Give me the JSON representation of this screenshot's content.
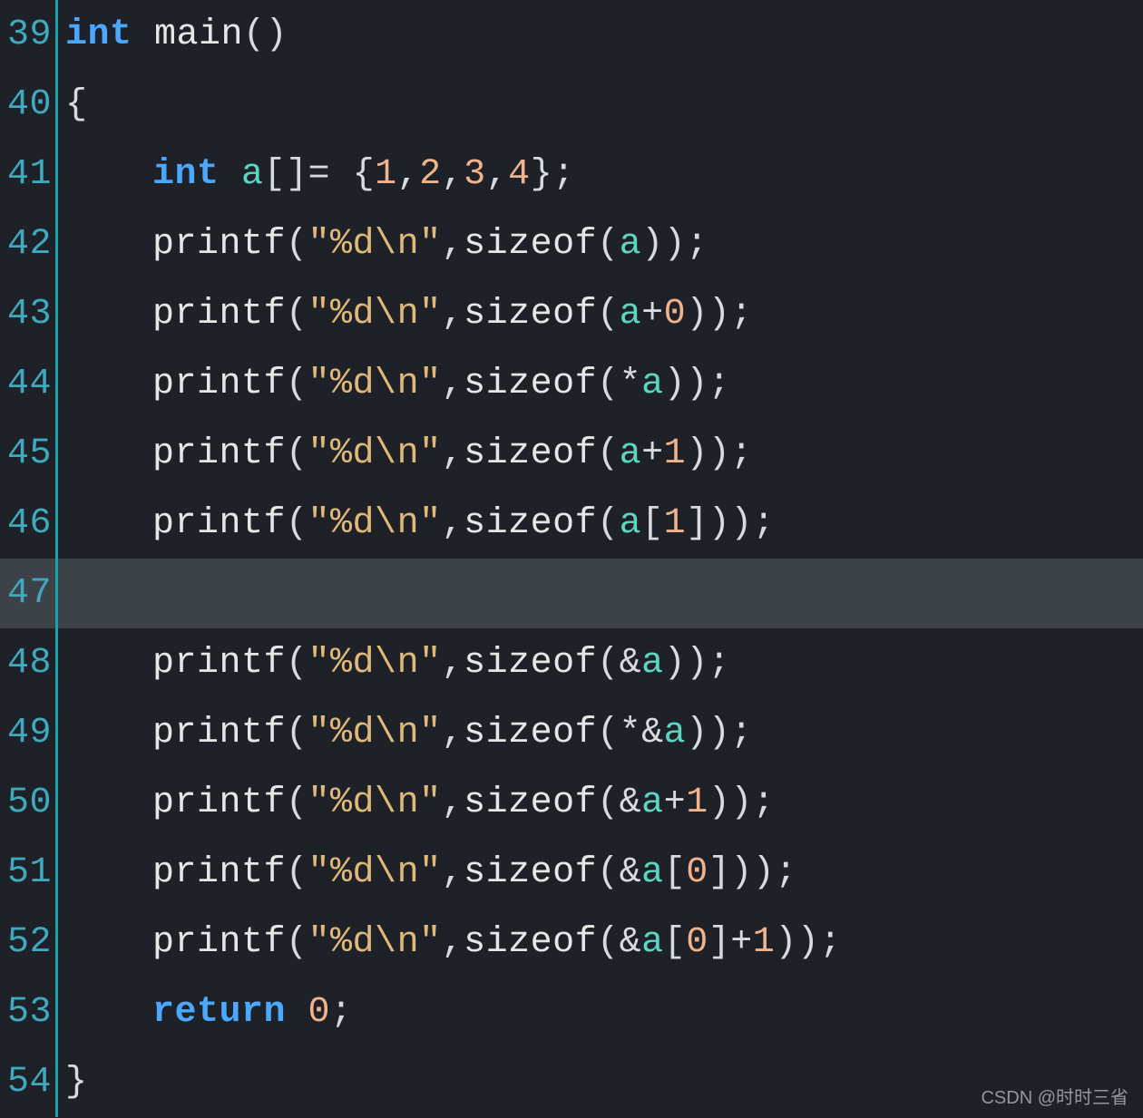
{
  "watermark": "CSDN @时时三省",
  "lines": [
    {
      "num": "39",
      "highlight": false,
      "indent": 0,
      "tokens": [
        {
          "t": "int ",
          "c": "c-kw"
        },
        {
          "t": "main",
          "c": "c-fn"
        },
        {
          "t": "(",
          "c": "c-par"
        },
        {
          "t": ")",
          "c": "c-par"
        }
      ]
    },
    {
      "num": "40",
      "highlight": false,
      "indent": 0,
      "tokens": [
        {
          "t": "{",
          "c": "c-pun"
        }
      ]
    },
    {
      "num": "41",
      "highlight": false,
      "indent": 1,
      "tokens": [
        {
          "t": "int ",
          "c": "c-kw"
        },
        {
          "t": "a",
          "c": "c-id"
        },
        {
          "t": "[]",
          "c": "c-pun"
        },
        {
          "t": "= ",
          "c": "c-op"
        },
        {
          "t": "{",
          "c": "c-pun"
        },
        {
          "t": "1",
          "c": "c-num"
        },
        {
          "t": ",",
          "c": "c-pun"
        },
        {
          "t": "2",
          "c": "c-num"
        },
        {
          "t": ",",
          "c": "c-pun"
        },
        {
          "t": "3",
          "c": "c-num"
        },
        {
          "t": ",",
          "c": "c-pun"
        },
        {
          "t": "4",
          "c": "c-num"
        },
        {
          "t": "};",
          "c": "c-pun"
        }
      ]
    },
    {
      "num": "42",
      "highlight": false,
      "indent": 1,
      "tokens": [
        {
          "t": "printf",
          "c": "c-fn"
        },
        {
          "t": "(",
          "c": "c-par"
        },
        {
          "t": "\"%d\\n\"",
          "c": "c-str"
        },
        {
          "t": ",",
          "c": "c-pun"
        },
        {
          "t": "sizeof",
          "c": "c-fn"
        },
        {
          "t": "(",
          "c": "c-par"
        },
        {
          "t": "a",
          "c": "c-id"
        },
        {
          "t": ")",
          "c": "c-par"
        },
        {
          "t": ")",
          "c": "c-par"
        },
        {
          "t": ";",
          "c": "c-pun"
        }
      ]
    },
    {
      "num": "43",
      "highlight": false,
      "indent": 1,
      "tokens": [
        {
          "t": "printf",
          "c": "c-fn"
        },
        {
          "t": "(",
          "c": "c-par"
        },
        {
          "t": "\"%d\\n\"",
          "c": "c-str"
        },
        {
          "t": ",",
          "c": "c-pun"
        },
        {
          "t": "sizeof",
          "c": "c-fn"
        },
        {
          "t": "(",
          "c": "c-par"
        },
        {
          "t": "a",
          "c": "c-id"
        },
        {
          "t": "+",
          "c": "c-op"
        },
        {
          "t": "0",
          "c": "c-num"
        },
        {
          "t": ")",
          "c": "c-par"
        },
        {
          "t": ")",
          "c": "c-par"
        },
        {
          "t": ";",
          "c": "c-pun"
        }
      ]
    },
    {
      "num": "44",
      "highlight": false,
      "indent": 1,
      "tokens": [
        {
          "t": "printf",
          "c": "c-fn"
        },
        {
          "t": "(",
          "c": "c-par"
        },
        {
          "t": "\"%d\\n\"",
          "c": "c-str"
        },
        {
          "t": ",",
          "c": "c-pun"
        },
        {
          "t": "sizeof",
          "c": "c-fn"
        },
        {
          "t": "(",
          "c": "c-par"
        },
        {
          "t": "*",
          "c": "c-op"
        },
        {
          "t": "a",
          "c": "c-id"
        },
        {
          "t": ")",
          "c": "c-par"
        },
        {
          "t": ")",
          "c": "c-par"
        },
        {
          "t": ";",
          "c": "c-pun"
        }
      ]
    },
    {
      "num": "45",
      "highlight": false,
      "indent": 1,
      "tokens": [
        {
          "t": "printf",
          "c": "c-fn"
        },
        {
          "t": "(",
          "c": "c-par"
        },
        {
          "t": "\"%d\\n\"",
          "c": "c-str"
        },
        {
          "t": ",",
          "c": "c-pun"
        },
        {
          "t": "sizeof",
          "c": "c-fn"
        },
        {
          "t": "(",
          "c": "c-par"
        },
        {
          "t": "a",
          "c": "c-id"
        },
        {
          "t": "+",
          "c": "c-op"
        },
        {
          "t": "1",
          "c": "c-num"
        },
        {
          "t": ")",
          "c": "c-par"
        },
        {
          "t": ")",
          "c": "c-par"
        },
        {
          "t": ";",
          "c": "c-pun"
        }
      ]
    },
    {
      "num": "46",
      "highlight": false,
      "indent": 1,
      "tokens": [
        {
          "t": "printf",
          "c": "c-fn"
        },
        {
          "t": "(",
          "c": "c-par"
        },
        {
          "t": "\"%d\\n\"",
          "c": "c-str"
        },
        {
          "t": ",",
          "c": "c-pun"
        },
        {
          "t": "sizeof",
          "c": "c-fn"
        },
        {
          "t": "(",
          "c": "c-par"
        },
        {
          "t": "a",
          "c": "c-id"
        },
        {
          "t": "[",
          "c": "c-pun"
        },
        {
          "t": "1",
          "c": "c-num"
        },
        {
          "t": "]",
          "c": "c-pun"
        },
        {
          "t": ")",
          "c": "c-par"
        },
        {
          "t": ")",
          "c": "c-par"
        },
        {
          "t": ";",
          "c": "c-pun"
        }
      ]
    },
    {
      "num": "47",
      "highlight": true,
      "indent": 0,
      "tokens": []
    },
    {
      "num": "48",
      "highlight": false,
      "indent": 1,
      "tokens": [
        {
          "t": "printf",
          "c": "c-fn"
        },
        {
          "t": "(",
          "c": "c-par"
        },
        {
          "t": "\"%d\\n\"",
          "c": "c-str"
        },
        {
          "t": ",",
          "c": "c-pun"
        },
        {
          "t": "sizeof",
          "c": "c-fn"
        },
        {
          "t": "(",
          "c": "c-par"
        },
        {
          "t": "&",
          "c": "c-op"
        },
        {
          "t": "a",
          "c": "c-id"
        },
        {
          "t": ")",
          "c": "c-par"
        },
        {
          "t": ")",
          "c": "c-par"
        },
        {
          "t": ";",
          "c": "c-pun"
        }
      ]
    },
    {
      "num": "49",
      "highlight": false,
      "indent": 1,
      "tokens": [
        {
          "t": "printf",
          "c": "c-fn"
        },
        {
          "t": "(",
          "c": "c-par"
        },
        {
          "t": "\"%d\\n\"",
          "c": "c-str"
        },
        {
          "t": ",",
          "c": "c-pun"
        },
        {
          "t": "sizeof",
          "c": "c-fn"
        },
        {
          "t": "(",
          "c": "c-par"
        },
        {
          "t": "*&",
          "c": "c-op"
        },
        {
          "t": "a",
          "c": "c-id"
        },
        {
          "t": ")",
          "c": "c-par"
        },
        {
          "t": ")",
          "c": "c-par"
        },
        {
          "t": ";",
          "c": "c-pun"
        }
      ]
    },
    {
      "num": "50",
      "highlight": false,
      "indent": 1,
      "tokens": [
        {
          "t": "printf",
          "c": "c-fn"
        },
        {
          "t": "(",
          "c": "c-par"
        },
        {
          "t": "\"%d\\n\"",
          "c": "c-str"
        },
        {
          "t": ",",
          "c": "c-pun"
        },
        {
          "t": "sizeof",
          "c": "c-fn"
        },
        {
          "t": "(",
          "c": "c-par"
        },
        {
          "t": "&",
          "c": "c-op"
        },
        {
          "t": "a",
          "c": "c-id"
        },
        {
          "t": "+",
          "c": "c-op"
        },
        {
          "t": "1",
          "c": "c-num"
        },
        {
          "t": ")",
          "c": "c-par"
        },
        {
          "t": ")",
          "c": "c-par"
        },
        {
          "t": ";",
          "c": "c-pun"
        }
      ]
    },
    {
      "num": "51",
      "highlight": false,
      "indent": 1,
      "tokens": [
        {
          "t": "printf",
          "c": "c-fn"
        },
        {
          "t": "(",
          "c": "c-par"
        },
        {
          "t": "\"%d\\n\"",
          "c": "c-str"
        },
        {
          "t": ",",
          "c": "c-pun"
        },
        {
          "t": "sizeof",
          "c": "c-fn"
        },
        {
          "t": "(",
          "c": "c-par"
        },
        {
          "t": "&",
          "c": "c-op"
        },
        {
          "t": "a",
          "c": "c-id"
        },
        {
          "t": "[",
          "c": "c-pun"
        },
        {
          "t": "0",
          "c": "c-num"
        },
        {
          "t": "]",
          "c": "c-pun"
        },
        {
          "t": ")",
          "c": "c-par"
        },
        {
          "t": ")",
          "c": "c-par"
        },
        {
          "t": ";",
          "c": "c-pun"
        }
      ]
    },
    {
      "num": "52",
      "highlight": false,
      "indent": 1,
      "tokens": [
        {
          "t": "printf",
          "c": "c-fn"
        },
        {
          "t": "(",
          "c": "c-par"
        },
        {
          "t": "\"%d\\n\"",
          "c": "c-str"
        },
        {
          "t": ",",
          "c": "c-pun"
        },
        {
          "t": "sizeof",
          "c": "c-fn"
        },
        {
          "t": "(",
          "c": "c-par"
        },
        {
          "t": "&",
          "c": "c-op"
        },
        {
          "t": "a",
          "c": "c-id"
        },
        {
          "t": "[",
          "c": "c-pun"
        },
        {
          "t": "0",
          "c": "c-num"
        },
        {
          "t": "]",
          "c": "c-pun"
        },
        {
          "t": "+",
          "c": "c-op"
        },
        {
          "t": "1",
          "c": "c-num"
        },
        {
          "t": ")",
          "c": "c-par"
        },
        {
          "t": ")",
          "c": "c-par"
        },
        {
          "t": ";",
          "c": "c-pun"
        }
      ]
    },
    {
      "num": "53",
      "highlight": false,
      "indent": 1,
      "tokens": [
        {
          "t": "return ",
          "c": "c-kw"
        },
        {
          "t": "0",
          "c": "c-num"
        },
        {
          "t": ";",
          "c": "c-pun"
        }
      ]
    },
    {
      "num": "54",
      "highlight": false,
      "indent": 0,
      "tokens": [
        {
          "t": "}",
          "c": "c-pun"
        }
      ]
    }
  ]
}
